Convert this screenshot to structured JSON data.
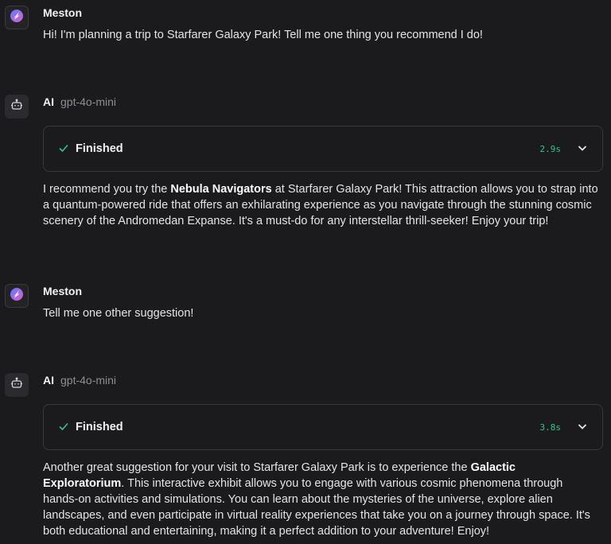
{
  "messages": [
    {
      "sender": "Meston",
      "text": "Hi! I'm planning a trip to Starfarer Galaxy Park! Tell me one thing you recommend I do!"
    },
    {
      "sender": "AI",
      "model": "gpt-4o-mini",
      "status": {
        "label": "Finished",
        "time": "2.9s"
      },
      "text_parts": [
        "I recommend you try the ",
        "Nebula Navigators",
        " at Starfarer Galaxy Park! This attraction allows you to strap into a quantum-powered ride that offers an exhilarating experience as you navigate through the stunning cosmic scenery of the Andromedan Expanse. It's a must-do for any interstellar thrill-seeker! Enjoy your trip!"
      ]
    },
    {
      "sender": "Meston",
      "text": "Tell me one other suggestion!"
    },
    {
      "sender": "AI",
      "model": "gpt-4o-mini",
      "status": {
        "label": "Finished",
        "time": "3.8s"
      },
      "text_parts": [
        "Another great suggestion for your visit to Starfarer Galaxy Park is to experience the ",
        "Galactic Exploratorium",
        ". This interactive exhibit allows you to engage with various cosmic phenomena through hands-on activities and simulations. You can learn about the mysteries of the universe, explore alien landscapes, and even participate in virtual reality experiences that take you on a journey through space. It's both educational and entertaining, making it a perfect addition to your adventure! Enjoy!"
      ]
    }
  ],
  "icons": {
    "user_avatar": "planet-logo-icon",
    "ai_avatar": "robot-icon",
    "status_check": "check-icon",
    "status_toggle": "chevron-down-icon"
  },
  "colors": {
    "background": "#1b1b1d",
    "status_time": "#2fc58f",
    "check": "#2fc58f",
    "avatar_gradient_start": "#5b7bff",
    "avatar_gradient_end": "#e05cd2"
  }
}
